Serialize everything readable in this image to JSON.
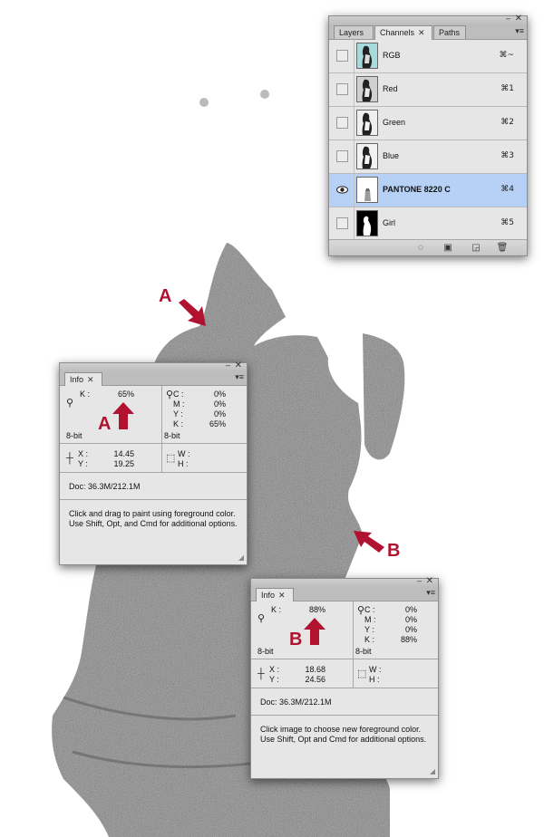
{
  "channels_panel": {
    "tabs": [
      {
        "label": "Layers",
        "active": false
      },
      {
        "label": "Channels",
        "active": true
      },
      {
        "label": "Paths",
        "active": false
      }
    ],
    "close_glyph": "✕",
    "min_glyph": "▬",
    "menu_glyph": "▾☰",
    "rows": [
      {
        "name": "RGB",
        "key": "⌘~",
        "visible": false,
        "selected": false
      },
      {
        "name": "Red",
        "key": "⌘1",
        "visible": false,
        "selected": false
      },
      {
        "name": "Green",
        "key": "⌘2",
        "visible": false,
        "selected": false
      },
      {
        "name": "Blue",
        "key": "⌘3",
        "visible": false,
        "selected": false
      },
      {
        "name": "PANTONE 8220 C",
        "key": "⌘4",
        "visible": true,
        "selected": true
      },
      {
        "name": "Girl",
        "key": "⌘5",
        "visible": false,
        "selected": false
      }
    ],
    "footer_buttons": [
      "load-selection-icon",
      "save-selection-icon",
      "new-channel-icon",
      "trash-icon"
    ],
    "eye_icon": "👁"
  },
  "info_a": {
    "tab": "Info",
    "k_label": "K :",
    "k_value": "65%",
    "c_label": "C :",
    "c_value": "0%",
    "m_label": "M :",
    "m_value": "0%",
    "y_label": "Y :",
    "y_value": "0%",
    "k2_label": "K :",
    "k2_value": "65%",
    "bit_left": "8-bit",
    "bit_right": "8-bit",
    "x_label": "X :",
    "x_value": "14.45",
    "y2_label": "Y :",
    "y2_value": "19.25",
    "w_label": "W :",
    "h_label": "H :",
    "doc": "Doc: 36.3M/212.1M",
    "hint": "Click and drag to paint using foreground color.  Use Shift, Opt, and Cmd for additional options.",
    "callout": "A"
  },
  "info_b": {
    "tab": "Info",
    "k_label": "K :",
    "k_value": "88%",
    "c_label": "C :",
    "c_value": "0%",
    "m_label": "M :",
    "m_value": "0%",
    "y_label": "Y :",
    "y_value": "0%",
    "k2_label": "K :",
    "k2_value": "88%",
    "bit_left": "8-bit",
    "bit_right": "8-bit",
    "x_label": "X :",
    "x_value": "18.68",
    "y2_label": "Y :",
    "y2_value": "24.56",
    "w_label": "W :",
    "h_label": "H :",
    "doc": "Doc: 36.3M/212.1M",
    "hint": "Click image to choose new foreground color.  Use Shift, Opt and Cmd for additional options.",
    "callout": "B"
  },
  "callouts": {
    "a": "A",
    "b": "B"
  },
  "colors": {
    "accent_red": "#b01230",
    "selected_row": "#b6d1f5"
  }
}
